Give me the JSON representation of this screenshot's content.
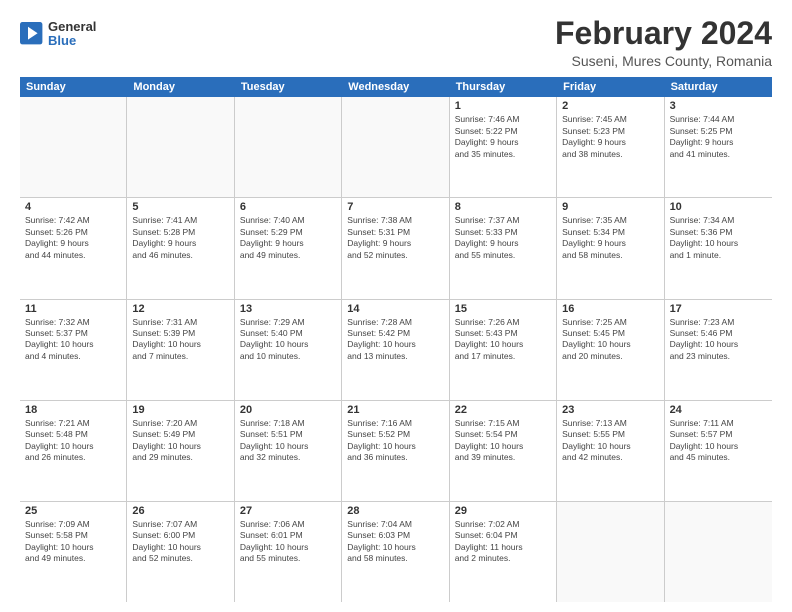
{
  "logo": {
    "general": "General",
    "blue": "Blue"
  },
  "title": "February 2024",
  "subtitle": "Suseni, Mures County, Romania",
  "days_of_week": [
    "Sunday",
    "Monday",
    "Tuesday",
    "Wednesday",
    "Thursday",
    "Friday",
    "Saturday"
  ],
  "rows": [
    [
      {
        "day": "",
        "info": ""
      },
      {
        "day": "",
        "info": ""
      },
      {
        "day": "",
        "info": ""
      },
      {
        "day": "",
        "info": ""
      },
      {
        "day": "1",
        "info": "Sunrise: 7:46 AM\nSunset: 5:22 PM\nDaylight: 9 hours\nand 35 minutes."
      },
      {
        "day": "2",
        "info": "Sunrise: 7:45 AM\nSunset: 5:23 PM\nDaylight: 9 hours\nand 38 minutes."
      },
      {
        "day": "3",
        "info": "Sunrise: 7:44 AM\nSunset: 5:25 PM\nDaylight: 9 hours\nand 41 minutes."
      }
    ],
    [
      {
        "day": "4",
        "info": "Sunrise: 7:42 AM\nSunset: 5:26 PM\nDaylight: 9 hours\nand 44 minutes."
      },
      {
        "day": "5",
        "info": "Sunrise: 7:41 AM\nSunset: 5:28 PM\nDaylight: 9 hours\nand 46 minutes."
      },
      {
        "day": "6",
        "info": "Sunrise: 7:40 AM\nSunset: 5:29 PM\nDaylight: 9 hours\nand 49 minutes."
      },
      {
        "day": "7",
        "info": "Sunrise: 7:38 AM\nSunset: 5:31 PM\nDaylight: 9 hours\nand 52 minutes."
      },
      {
        "day": "8",
        "info": "Sunrise: 7:37 AM\nSunset: 5:33 PM\nDaylight: 9 hours\nand 55 minutes."
      },
      {
        "day": "9",
        "info": "Sunrise: 7:35 AM\nSunset: 5:34 PM\nDaylight: 9 hours\nand 58 minutes."
      },
      {
        "day": "10",
        "info": "Sunrise: 7:34 AM\nSunset: 5:36 PM\nDaylight: 10 hours\nand 1 minute."
      }
    ],
    [
      {
        "day": "11",
        "info": "Sunrise: 7:32 AM\nSunset: 5:37 PM\nDaylight: 10 hours\nand 4 minutes."
      },
      {
        "day": "12",
        "info": "Sunrise: 7:31 AM\nSunset: 5:39 PM\nDaylight: 10 hours\nand 7 minutes."
      },
      {
        "day": "13",
        "info": "Sunrise: 7:29 AM\nSunset: 5:40 PM\nDaylight: 10 hours\nand 10 minutes."
      },
      {
        "day": "14",
        "info": "Sunrise: 7:28 AM\nSunset: 5:42 PM\nDaylight: 10 hours\nand 13 minutes."
      },
      {
        "day": "15",
        "info": "Sunrise: 7:26 AM\nSunset: 5:43 PM\nDaylight: 10 hours\nand 17 minutes."
      },
      {
        "day": "16",
        "info": "Sunrise: 7:25 AM\nSunset: 5:45 PM\nDaylight: 10 hours\nand 20 minutes."
      },
      {
        "day": "17",
        "info": "Sunrise: 7:23 AM\nSunset: 5:46 PM\nDaylight: 10 hours\nand 23 minutes."
      }
    ],
    [
      {
        "day": "18",
        "info": "Sunrise: 7:21 AM\nSunset: 5:48 PM\nDaylight: 10 hours\nand 26 minutes."
      },
      {
        "day": "19",
        "info": "Sunrise: 7:20 AM\nSunset: 5:49 PM\nDaylight: 10 hours\nand 29 minutes."
      },
      {
        "day": "20",
        "info": "Sunrise: 7:18 AM\nSunset: 5:51 PM\nDaylight: 10 hours\nand 32 minutes."
      },
      {
        "day": "21",
        "info": "Sunrise: 7:16 AM\nSunset: 5:52 PM\nDaylight: 10 hours\nand 36 minutes."
      },
      {
        "day": "22",
        "info": "Sunrise: 7:15 AM\nSunset: 5:54 PM\nDaylight: 10 hours\nand 39 minutes."
      },
      {
        "day": "23",
        "info": "Sunrise: 7:13 AM\nSunset: 5:55 PM\nDaylight: 10 hours\nand 42 minutes."
      },
      {
        "day": "24",
        "info": "Sunrise: 7:11 AM\nSunset: 5:57 PM\nDaylight: 10 hours\nand 45 minutes."
      }
    ],
    [
      {
        "day": "25",
        "info": "Sunrise: 7:09 AM\nSunset: 5:58 PM\nDaylight: 10 hours\nand 49 minutes."
      },
      {
        "day": "26",
        "info": "Sunrise: 7:07 AM\nSunset: 6:00 PM\nDaylight: 10 hours\nand 52 minutes."
      },
      {
        "day": "27",
        "info": "Sunrise: 7:06 AM\nSunset: 6:01 PM\nDaylight: 10 hours\nand 55 minutes."
      },
      {
        "day": "28",
        "info": "Sunrise: 7:04 AM\nSunset: 6:03 PM\nDaylight: 10 hours\nand 58 minutes."
      },
      {
        "day": "29",
        "info": "Sunrise: 7:02 AM\nSunset: 6:04 PM\nDaylight: 11 hours\nand 2 minutes."
      },
      {
        "day": "",
        "info": ""
      },
      {
        "day": "",
        "info": ""
      }
    ]
  ]
}
